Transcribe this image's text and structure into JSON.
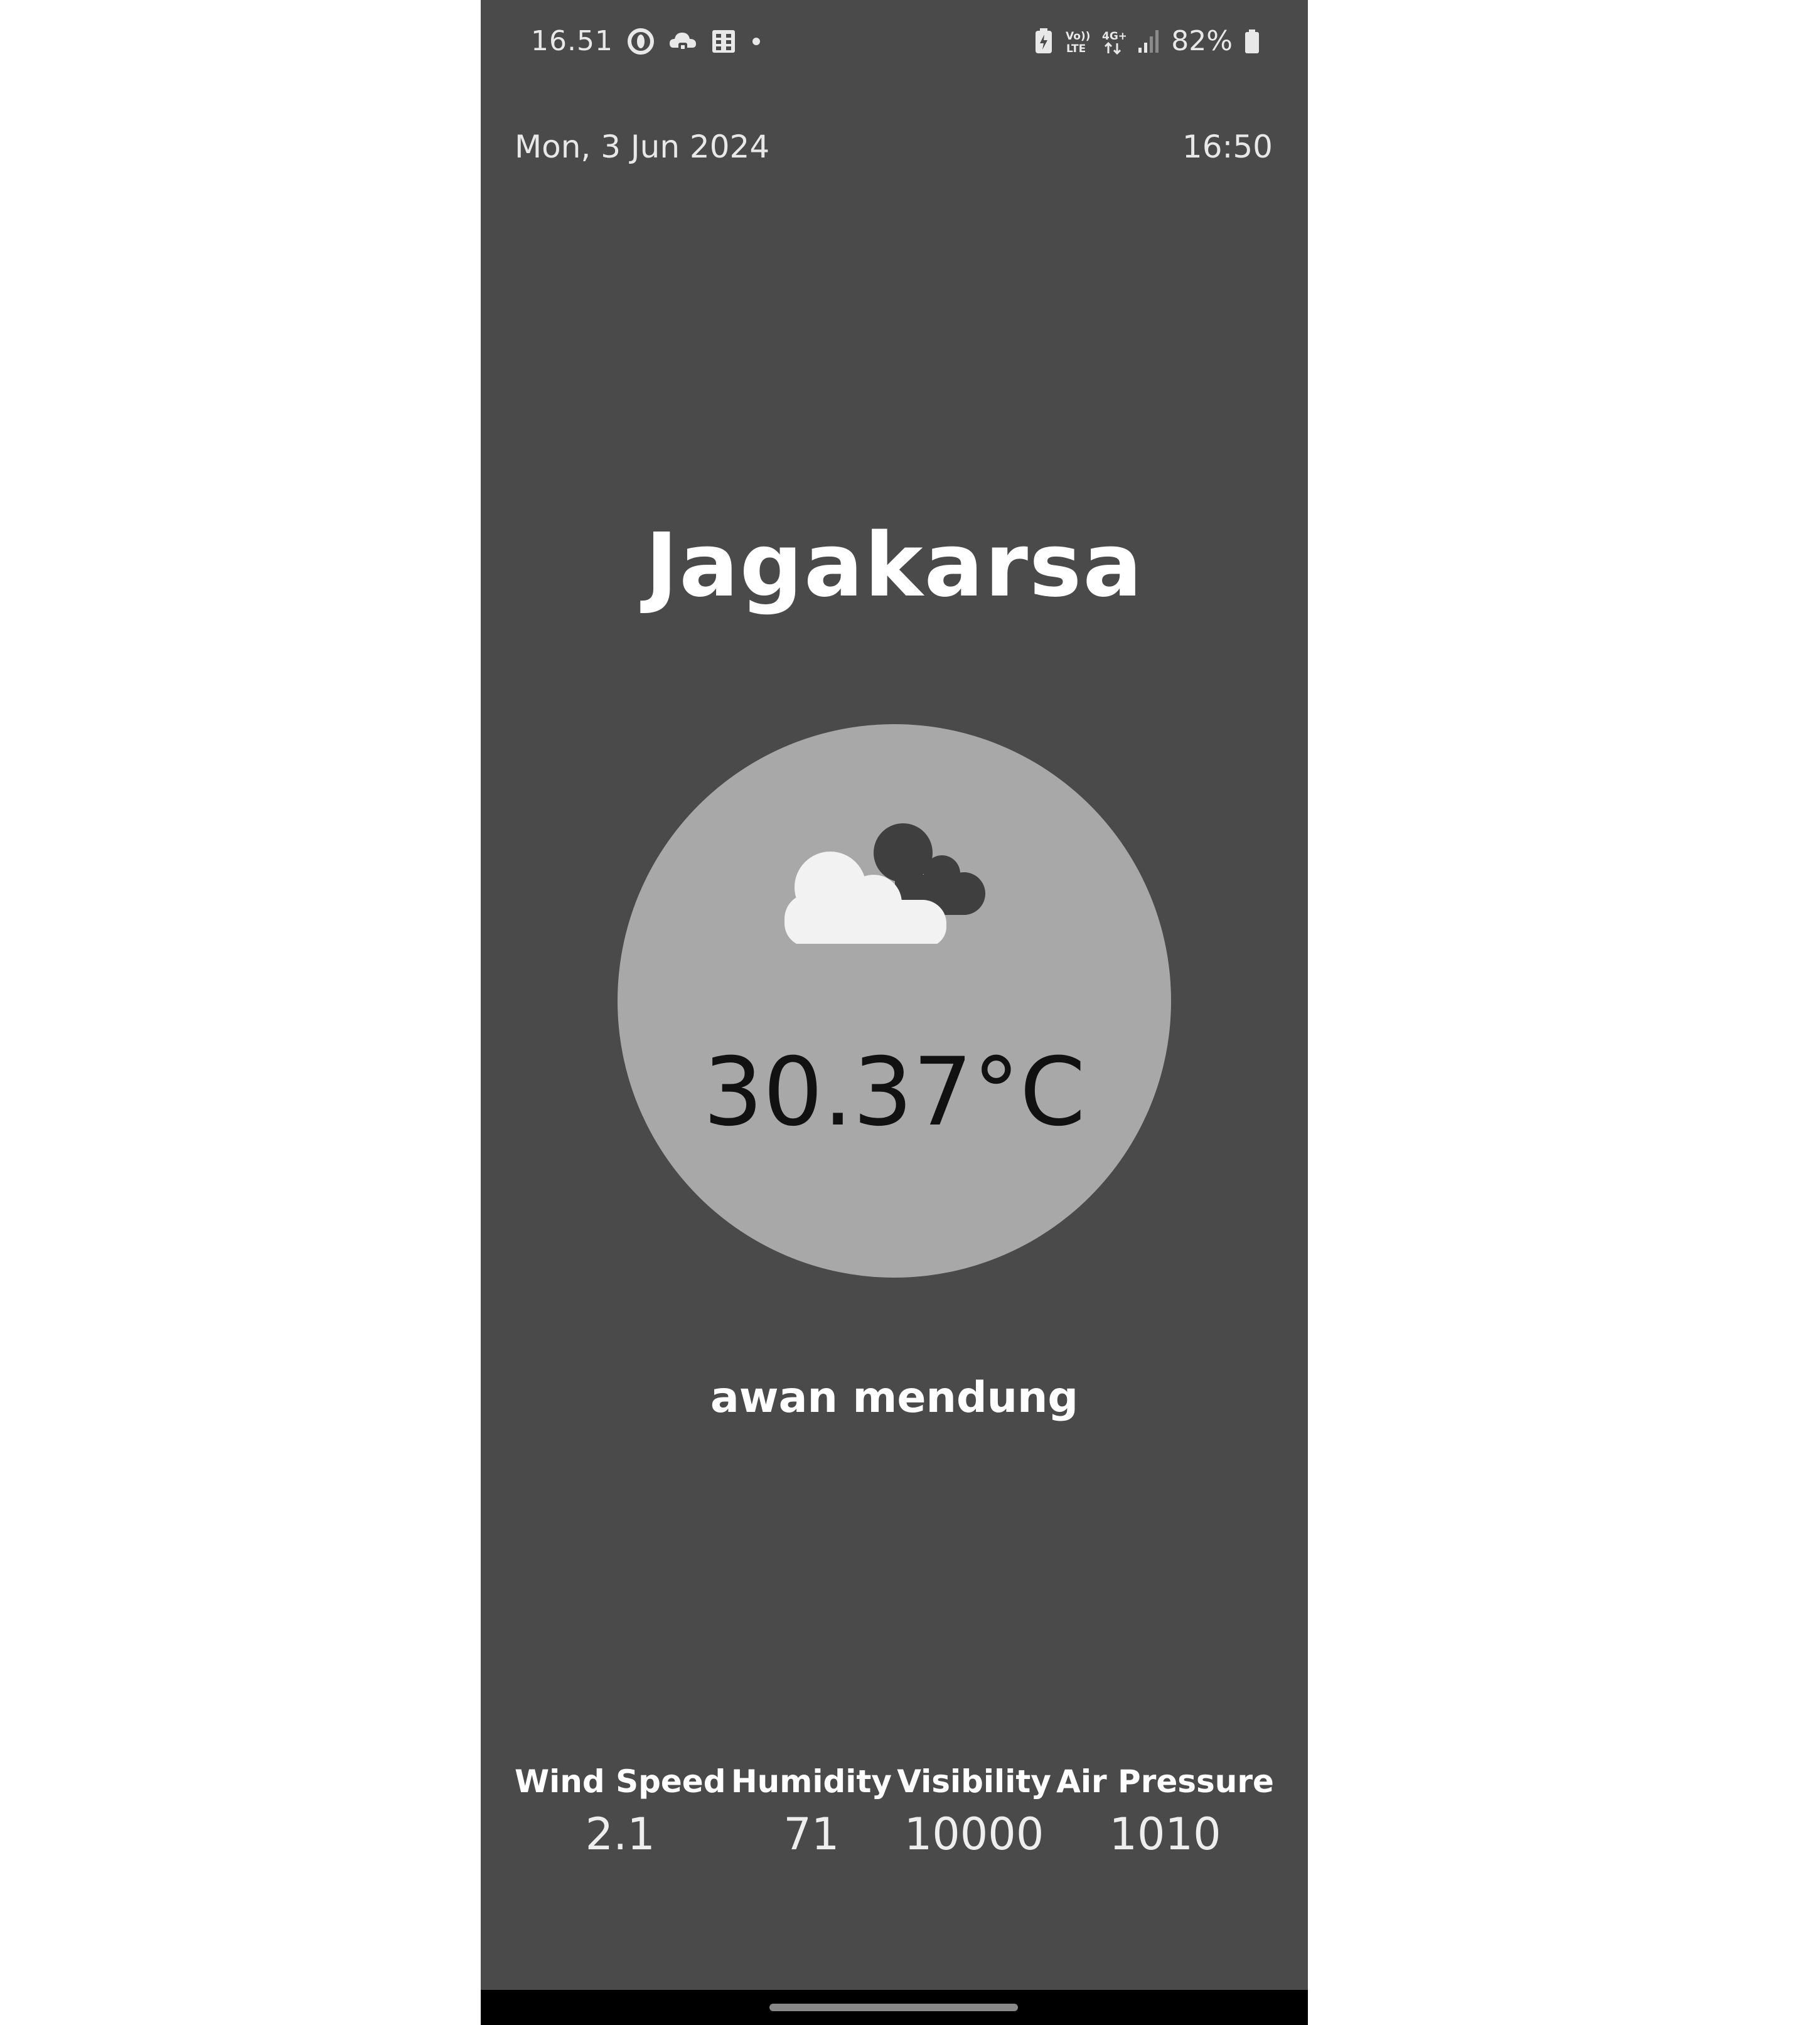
{
  "status_bar": {
    "time": "16.51",
    "battery": "82%",
    "icons": [
      "opera-icon",
      "cloud-game-icon",
      "grid-app-icon",
      "dot-icon",
      "battery-saver-icon",
      "volte-icon",
      "4g-data-icon",
      "signal-icon",
      "battery-icon"
    ]
  },
  "header": {
    "date": "Mon, 3 Jun 2024",
    "time": "16:50"
  },
  "weather": {
    "city": "Jagakarsa",
    "icon": "cloudy-icon",
    "temperature": "30.37°C",
    "description": "awan mendung"
  },
  "stats": [
    {
      "label": "Wind Speed",
      "value": "2.1"
    },
    {
      "label": "Humidity",
      "value": "71"
    },
    {
      "label": "Visibility",
      "value": "10000"
    },
    {
      "label": "Air Pressure",
      "value": "1010"
    }
  ],
  "colors": {
    "background": "#4a4a4a",
    "circle": "#a8a8a8",
    "cloud_front": "#f2f2f2",
    "cloud_back": "#3f3f3f"
  }
}
